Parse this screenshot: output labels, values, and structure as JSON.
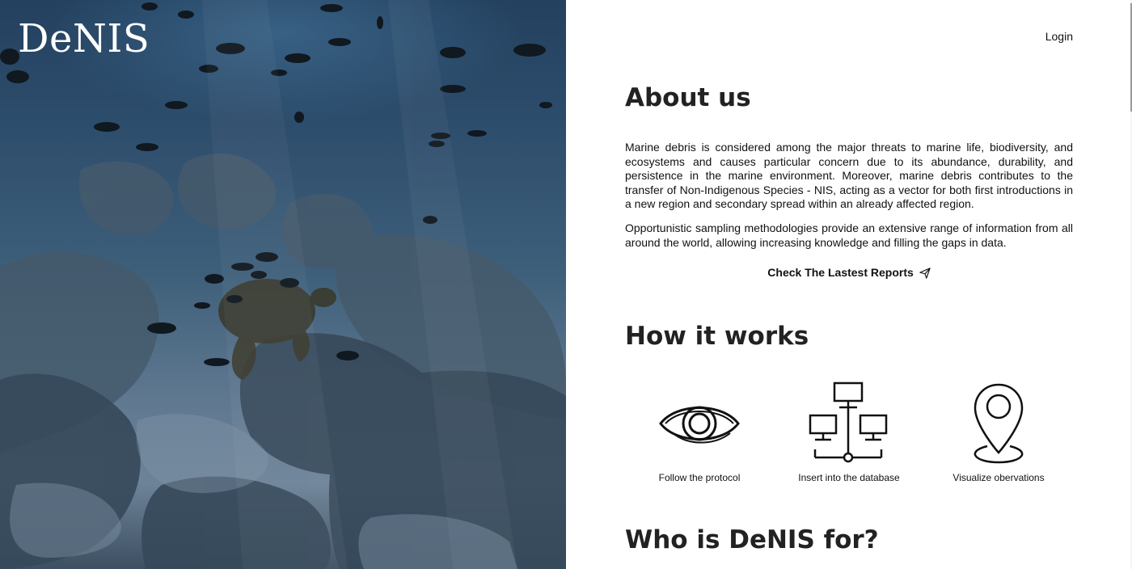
{
  "brand": {
    "logo_text": "DeNIS"
  },
  "header": {
    "login_label": "Login"
  },
  "about": {
    "title": "About us",
    "paragraph1": "Marine debris is considered among the major threats to marine life, biodiversity, and ecosystems and causes particular concern due to its abundance, durability, and persistence in the marine environment. Moreover, marine debris contributes to the transfer of Non-Indigenous Species - NIS, acting as a vector for both first introductions in a new region and secondary spread within an already affected region.",
    "paragraph2": "Opportunistic sampling methodologies provide an extensive range of information from all around the world, allowing increasing knowledge and filling the gaps in data.",
    "reports_link": "Check The Lastest Reports",
    "reports_icon": "paper-plane-icon"
  },
  "how": {
    "title": "How it works",
    "steps": [
      {
        "icon": "eye-icon",
        "label": "Follow the protocol"
      },
      {
        "icon": "network-icon",
        "label": "Insert into the database"
      },
      {
        "icon": "map-pin-icon",
        "label": "Visualize obervations"
      }
    ]
  },
  "who": {
    "title": "Who is DeNIS for?"
  },
  "colors": {
    "text": "#222222",
    "hero_water": "#2d4d6c",
    "background": "#ffffff"
  }
}
